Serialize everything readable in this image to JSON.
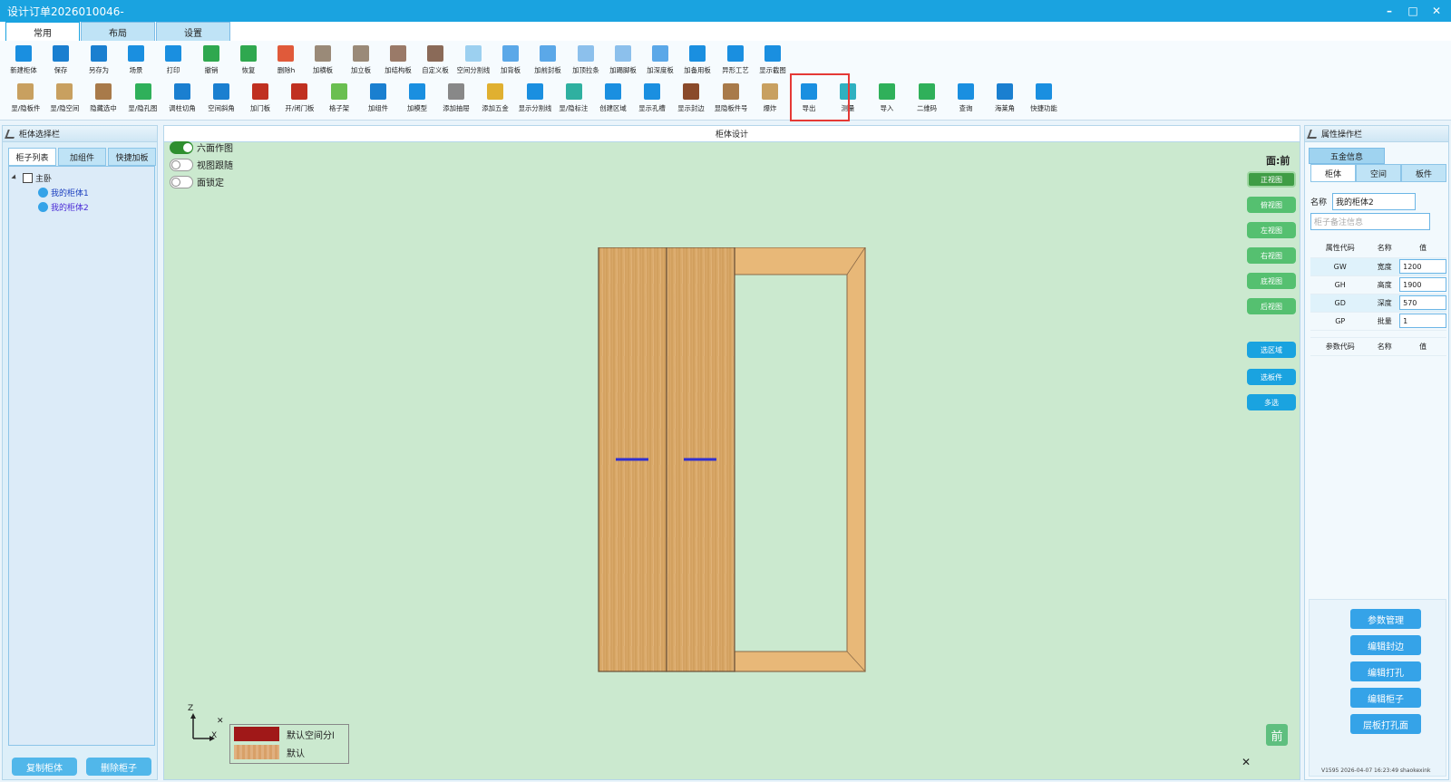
{
  "window": {
    "title": "设计订单2026010046-",
    "min": "–",
    "max": "□",
    "close": "✕"
  },
  "ribbon_tabs": [
    {
      "label": "常用"
    },
    {
      "label": "布局"
    },
    {
      "label": "设置"
    }
  ],
  "toolbar": {
    "row1": [
      {
        "label": "新建柜体",
        "icon": "new-cabinet-icon",
        "color": "#1a8fe0"
      },
      {
        "label": "保存",
        "icon": "save-icon",
        "color": "#1a7fd0"
      },
      {
        "label": "另存为",
        "icon": "save-as-icon",
        "color": "#1a7fd0"
      },
      {
        "label": "场景",
        "icon": "scene-icon",
        "color": "#1a8fe0"
      },
      {
        "label": "打印",
        "icon": "print-icon",
        "color": "#1a8fe0"
      },
      {
        "label": "撤销",
        "icon": "undo-icon",
        "color": "#2fa84f"
      },
      {
        "label": "恢复",
        "icon": "redo-icon",
        "color": "#2fa84f"
      },
      {
        "label": "删除h",
        "icon": "delete-icon",
        "color": "#e05a3a"
      },
      {
        "label": "加横板",
        "icon": "add-horizontal-board-icon",
        "color": "#9a8a78"
      },
      {
        "label": "加立板",
        "icon": "add-vertical-board-icon",
        "color": "#9a8a78"
      },
      {
        "label": "加结构板",
        "icon": "add-structure-board-icon",
        "color": "#9a7a68"
      },
      {
        "label": "自定义板",
        "icon": "custom-board-icon",
        "color": "#8a6a58"
      },
      {
        "label": "空间分割线",
        "icon": "space-divider-icon",
        "color": "#9cd0f0"
      },
      {
        "label": "加背板",
        "icon": "add-back-board-icon",
        "color": "#5ba8e8"
      },
      {
        "label": "加前封板",
        "icon": "add-front-seal-icon",
        "color": "#5ba8e8"
      },
      {
        "label": "加顶拉条",
        "icon": "add-top-strip-icon",
        "color": "#8cc0ec"
      },
      {
        "label": "加踢脚板",
        "icon": "add-skirting-icon",
        "color": "#8cc0ec"
      },
      {
        "label": "加深度板",
        "icon": "add-depth-board-icon",
        "color": "#5ba8e8"
      },
      {
        "label": "加备用板",
        "icon": "add-spare-board-icon",
        "color": "#1a8fe0"
      },
      {
        "label": "异形工艺",
        "icon": "special-process-icon",
        "color": "#1a8fe0"
      },
      {
        "label": "显示截图",
        "icon": "show-screenshot-icon",
        "color": "#1a8fe0"
      }
    ],
    "row2": [
      {
        "label": "显/隐板件",
        "icon": "toggle-boards-icon",
        "color": "#c8a060"
      },
      {
        "label": "显/隐空间",
        "icon": "toggle-space-icon",
        "color": "#c8a060"
      },
      {
        "label": "隐藏选中",
        "icon": "hide-selected-icon",
        "color": "#a87a4a"
      },
      {
        "label": "显/隐孔图",
        "icon": "toggle-holes-icon",
        "color": "#2fb05a"
      },
      {
        "label": "调柱切角",
        "icon": "column-cut-icon",
        "color": "#1a7fd0"
      },
      {
        "label": "空间斜角",
        "icon": "space-bevel-icon",
        "color": "#1a7fd0"
      },
      {
        "label": "加门板",
        "icon": "add-door-icon",
        "color": "#c03020"
      },
      {
        "label": "开/闭门板",
        "icon": "open-close-door-icon",
        "color": "#c03020"
      },
      {
        "label": "格子架",
        "icon": "grid-rack-icon",
        "color": "#6abf50"
      },
      {
        "label": "加组件",
        "icon": "add-component-icon",
        "color": "#1a7fd0"
      },
      {
        "label": "加模型",
        "icon": "add-model-icon",
        "color": "#1a8fe0"
      },
      {
        "label": "添加抽屉",
        "icon": "add-drawer-icon",
        "color": "#888"
      },
      {
        "label": "添加五金",
        "icon": "add-hardware-icon",
        "color": "#e0b030"
      },
      {
        "label": "显示分割线",
        "icon": "show-divider-icon",
        "color": "#1a8fe0"
      },
      {
        "label": "显/隐标注",
        "icon": "toggle-annotation-icon",
        "color": "#2fb0a0"
      },
      {
        "label": "创建区域",
        "icon": "create-region-icon",
        "color": "#1a8fe0"
      },
      {
        "label": "显示孔槽",
        "icon": "show-holes-icon",
        "color": "#1a8fe0"
      },
      {
        "label": "显示封边",
        "icon": "show-edge-icon",
        "color": "#8a4a2a"
      },
      {
        "label": "显隐板件号",
        "icon": "toggle-board-number-icon",
        "color": "#a87a4a"
      },
      {
        "label": "爆炸",
        "icon": "explode-icon",
        "color": "#c8a060"
      },
      {
        "label": "导出",
        "icon": "export-icon",
        "color": "#1a8fe0"
      },
      {
        "label": "测量",
        "icon": "measure-icon",
        "color": "#2fb0c0"
      },
      {
        "label": "导入",
        "icon": "import-icon",
        "color": "#2fb05a"
      },
      {
        "label": "二维码",
        "icon": "qr-code-icon",
        "color": "#2fb05a"
      },
      {
        "label": "查询",
        "icon": "query-icon",
        "color": "#1a8fe0"
      },
      {
        "label": "海莱角",
        "icon": "corner-icon",
        "color": "#1a7fd0"
      },
      {
        "label": "快捷功能",
        "icon": "shortcut-icon",
        "color": "#1a8fe0"
      }
    ]
  },
  "left_panel": {
    "title": "柜体选择栏",
    "tabs": [
      {
        "label": "柜子列表"
      },
      {
        "label": "加组件"
      },
      {
        "label": "快捷加板"
      }
    ],
    "tree": {
      "root": "主卧",
      "children": [
        "我的柜体1",
        "我的柜体2"
      ]
    },
    "copy_button": "复制柜体",
    "delete_button": "删除柜子"
  },
  "center": {
    "title": "柜体设计",
    "toggles": [
      {
        "label": "六面作图",
        "on": true
      },
      {
        "label": "视图跟随",
        "on": false
      },
      {
        "label": "面锁定",
        "on": false
      }
    ],
    "face_label": "面:前",
    "view_buttons": [
      "正视图",
      "俯视图",
      "左视图",
      "右视图",
      "底视图",
      "后视图"
    ],
    "select_buttons": [
      "选区域",
      "选板件",
      "多选"
    ],
    "legend": [
      {
        "label": "默认空间分l",
        "color": "#a01818"
      },
      {
        "label": "默认",
        "color": "#e0b080"
      }
    ],
    "axis": {
      "z": "Z",
      "x": "X",
      "close": "✕"
    },
    "front_badge": "前",
    "close": "✕",
    "colors": {
      "wood": "#d9a868",
      "wood_dark": "#b88548",
      "handle": "#3030d0",
      "frame": "#e8b878"
    }
  },
  "right_panel": {
    "title": "属性操作栏",
    "hardware_tab": "五金信息",
    "tabs": [
      {
        "label": "柜体"
      },
      {
        "label": "空间"
      },
      {
        "label": "板件"
      }
    ],
    "name_label": "名称",
    "name_value": "我的柜体2",
    "remark_placeholder": "柜子备注信息",
    "table_header": {
      "code": "属性代码",
      "name": "名称",
      "value": "值"
    },
    "properties": [
      {
        "code": "GW",
        "name": "宽度",
        "value": "1200"
      },
      {
        "code": "GH",
        "name": "高度",
        "value": "1900"
      },
      {
        "code": "GD",
        "name": "深度",
        "value": "570"
      },
      {
        "code": "GP",
        "name": "批量",
        "value": "1"
      }
    ],
    "param_header": {
      "code": "参数代码",
      "name": "名称",
      "value": "值"
    },
    "actions": [
      "参数管理",
      "编辑封边",
      "编辑打孔",
      "编辑柜子",
      "层板打孔面"
    ],
    "version": "V1595 2026-04-07 16:23:49 shaokexink"
  }
}
